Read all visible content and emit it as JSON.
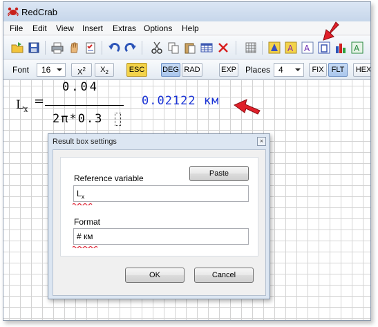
{
  "app": {
    "title": "RedCrab"
  },
  "menu": [
    "File",
    "Edit",
    "View",
    "Insert",
    "Extras",
    "Options",
    "Help"
  ],
  "toolbar": {
    "icons": [
      "open-icon",
      "save-icon",
      "print-icon",
      "hand-icon",
      "checklist-icon",
      "undo-icon",
      "redo-icon",
      "cut-icon",
      "copy-icon",
      "paste-icon",
      "table-icon",
      "delete-icon",
      "grid-icon",
      "chart-a-icon",
      "chart-b-icon",
      "chart-c-icon",
      "result-box-icon",
      "bar-chart-icon",
      "spreadsheet-icon"
    ]
  },
  "formatbar": {
    "font_label": "Font",
    "font_size": "16",
    "superscript_label": "X",
    "superscript_exp": "2",
    "subscript_label": "X",
    "subscript_idx": "2",
    "esc_label": "ESC",
    "deg_label": "DEG",
    "rad_label": "RAD",
    "exp_label": "EXP",
    "places_label": "Places",
    "places_value": "4",
    "fix_label": "FIX",
    "flt_label": "FLT",
    "hex_label": "HEX"
  },
  "worksheet": {
    "lhs_var": "L",
    "lhs_sub": "x",
    "equals": "=",
    "numerator": "0.04",
    "denominator": "2π*0.3",
    "result": "0.02122 км"
  },
  "dialog": {
    "title": "Result box settings",
    "close_glyph": "×",
    "paste_label": "Paste",
    "reference_label": "Reference variable",
    "reference_var": "L",
    "reference_sub": "x",
    "format_label": "Format",
    "format_value": "# км",
    "ok_label": "OK",
    "cancel_label": "Cancel"
  },
  "colors": {
    "result": "#1a33d6",
    "arrow": "#e0202a",
    "esc": "#f3d34a",
    "squiggle": "#e02a3a"
  }
}
